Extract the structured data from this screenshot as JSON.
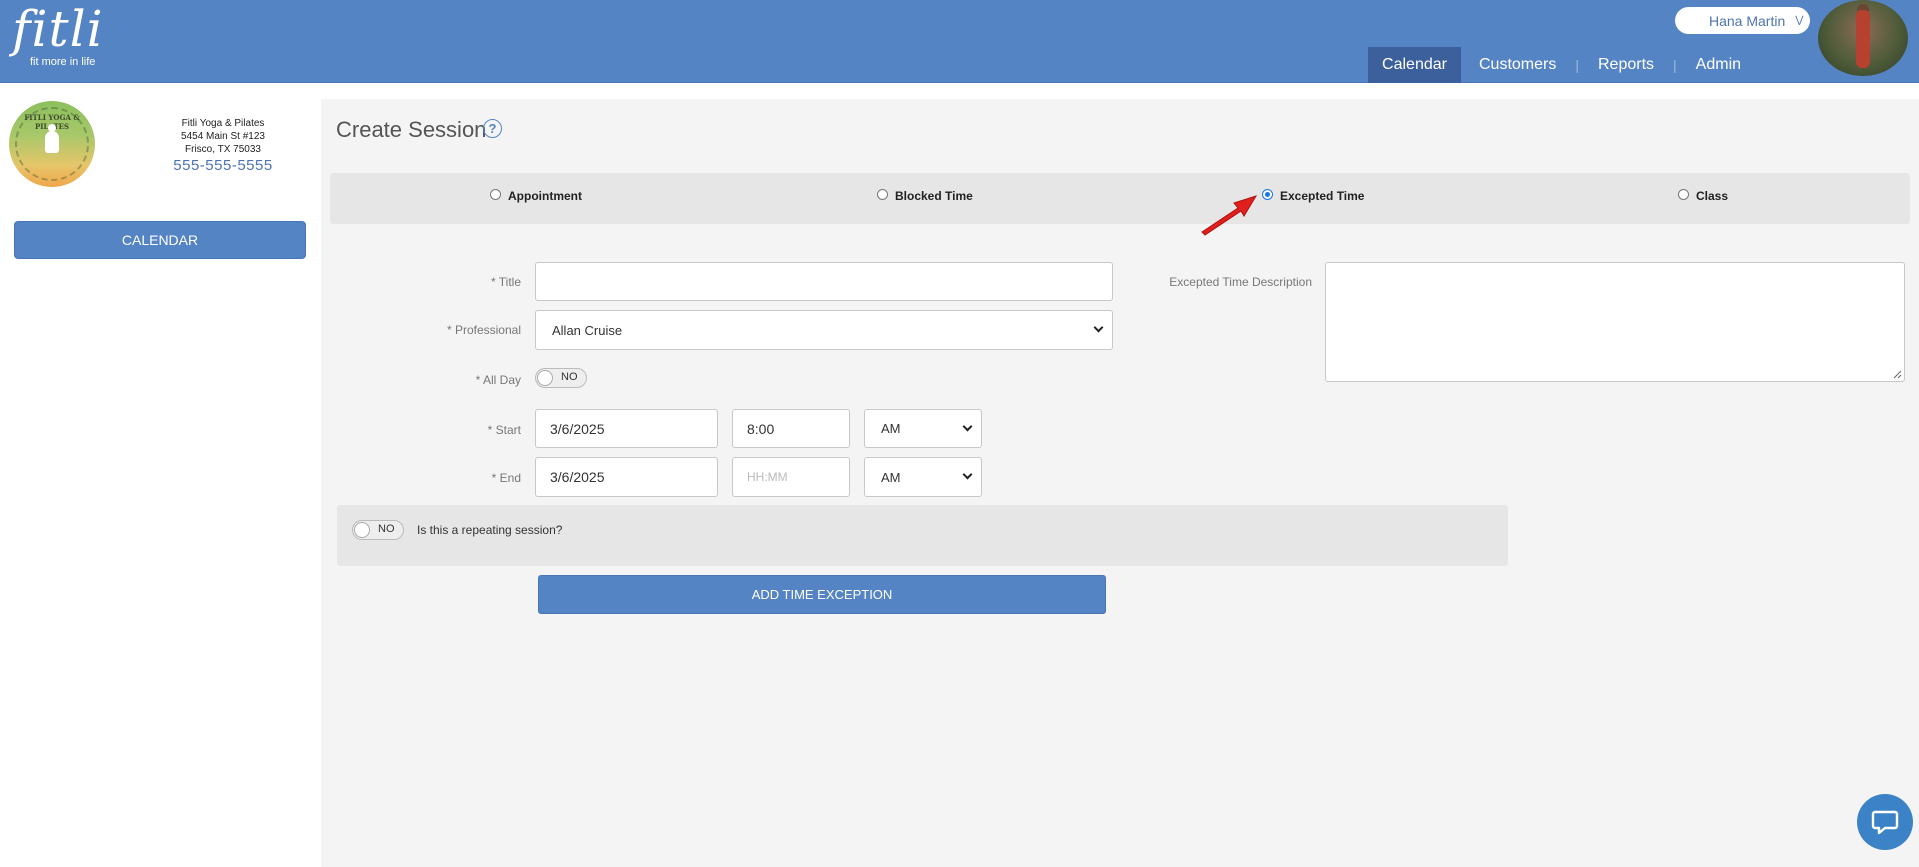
{
  "header": {
    "logo_word": "fitli",
    "logo_tagline": "fit more in life",
    "user_name": "Hana Martin",
    "nav": [
      {
        "label": "Calendar"
      },
      {
        "label": "Customers"
      },
      {
        "label": "Reports"
      },
      {
        "label": "Admin"
      }
    ],
    "brand_color": "#5584c4"
  },
  "sidebar": {
    "studio_name": "Fitli Yoga & Pilates",
    "address_line1": "5454 Main St #123",
    "address_line2": "Frisco, TX 75033",
    "phone": "555-555-5555",
    "calendar_button": "CALENDAR",
    "logo_text": "FITLI YOGA & PILATES"
  },
  "form": {
    "page_title": "Create Session",
    "session_types": [
      {
        "label": "Appointment",
        "checked": false
      },
      {
        "label": "Blocked Time",
        "checked": false
      },
      {
        "label": "Excepted Time",
        "checked": true
      },
      {
        "label": "Class",
        "checked": false
      }
    ],
    "title_label": "* Title",
    "title_value": "",
    "professional_label": "* Professional",
    "professional_value": "Allan Cruise",
    "all_day_label": "* All Day",
    "all_day_toggle": "NO",
    "start_label": "* Start",
    "start_date": "3/6/2025",
    "start_time": "8:00",
    "start_ampm": "AM",
    "end_label": "* End",
    "end_date": "3/6/2025",
    "end_time_placeholder": "HH:MM",
    "end_ampm": "AM",
    "repeat_toggle": "NO",
    "repeat_question": "Is this a repeating session?",
    "submit_button": "ADD TIME EXCEPTION",
    "description_label": "Excepted Time Description",
    "description_value": ""
  }
}
